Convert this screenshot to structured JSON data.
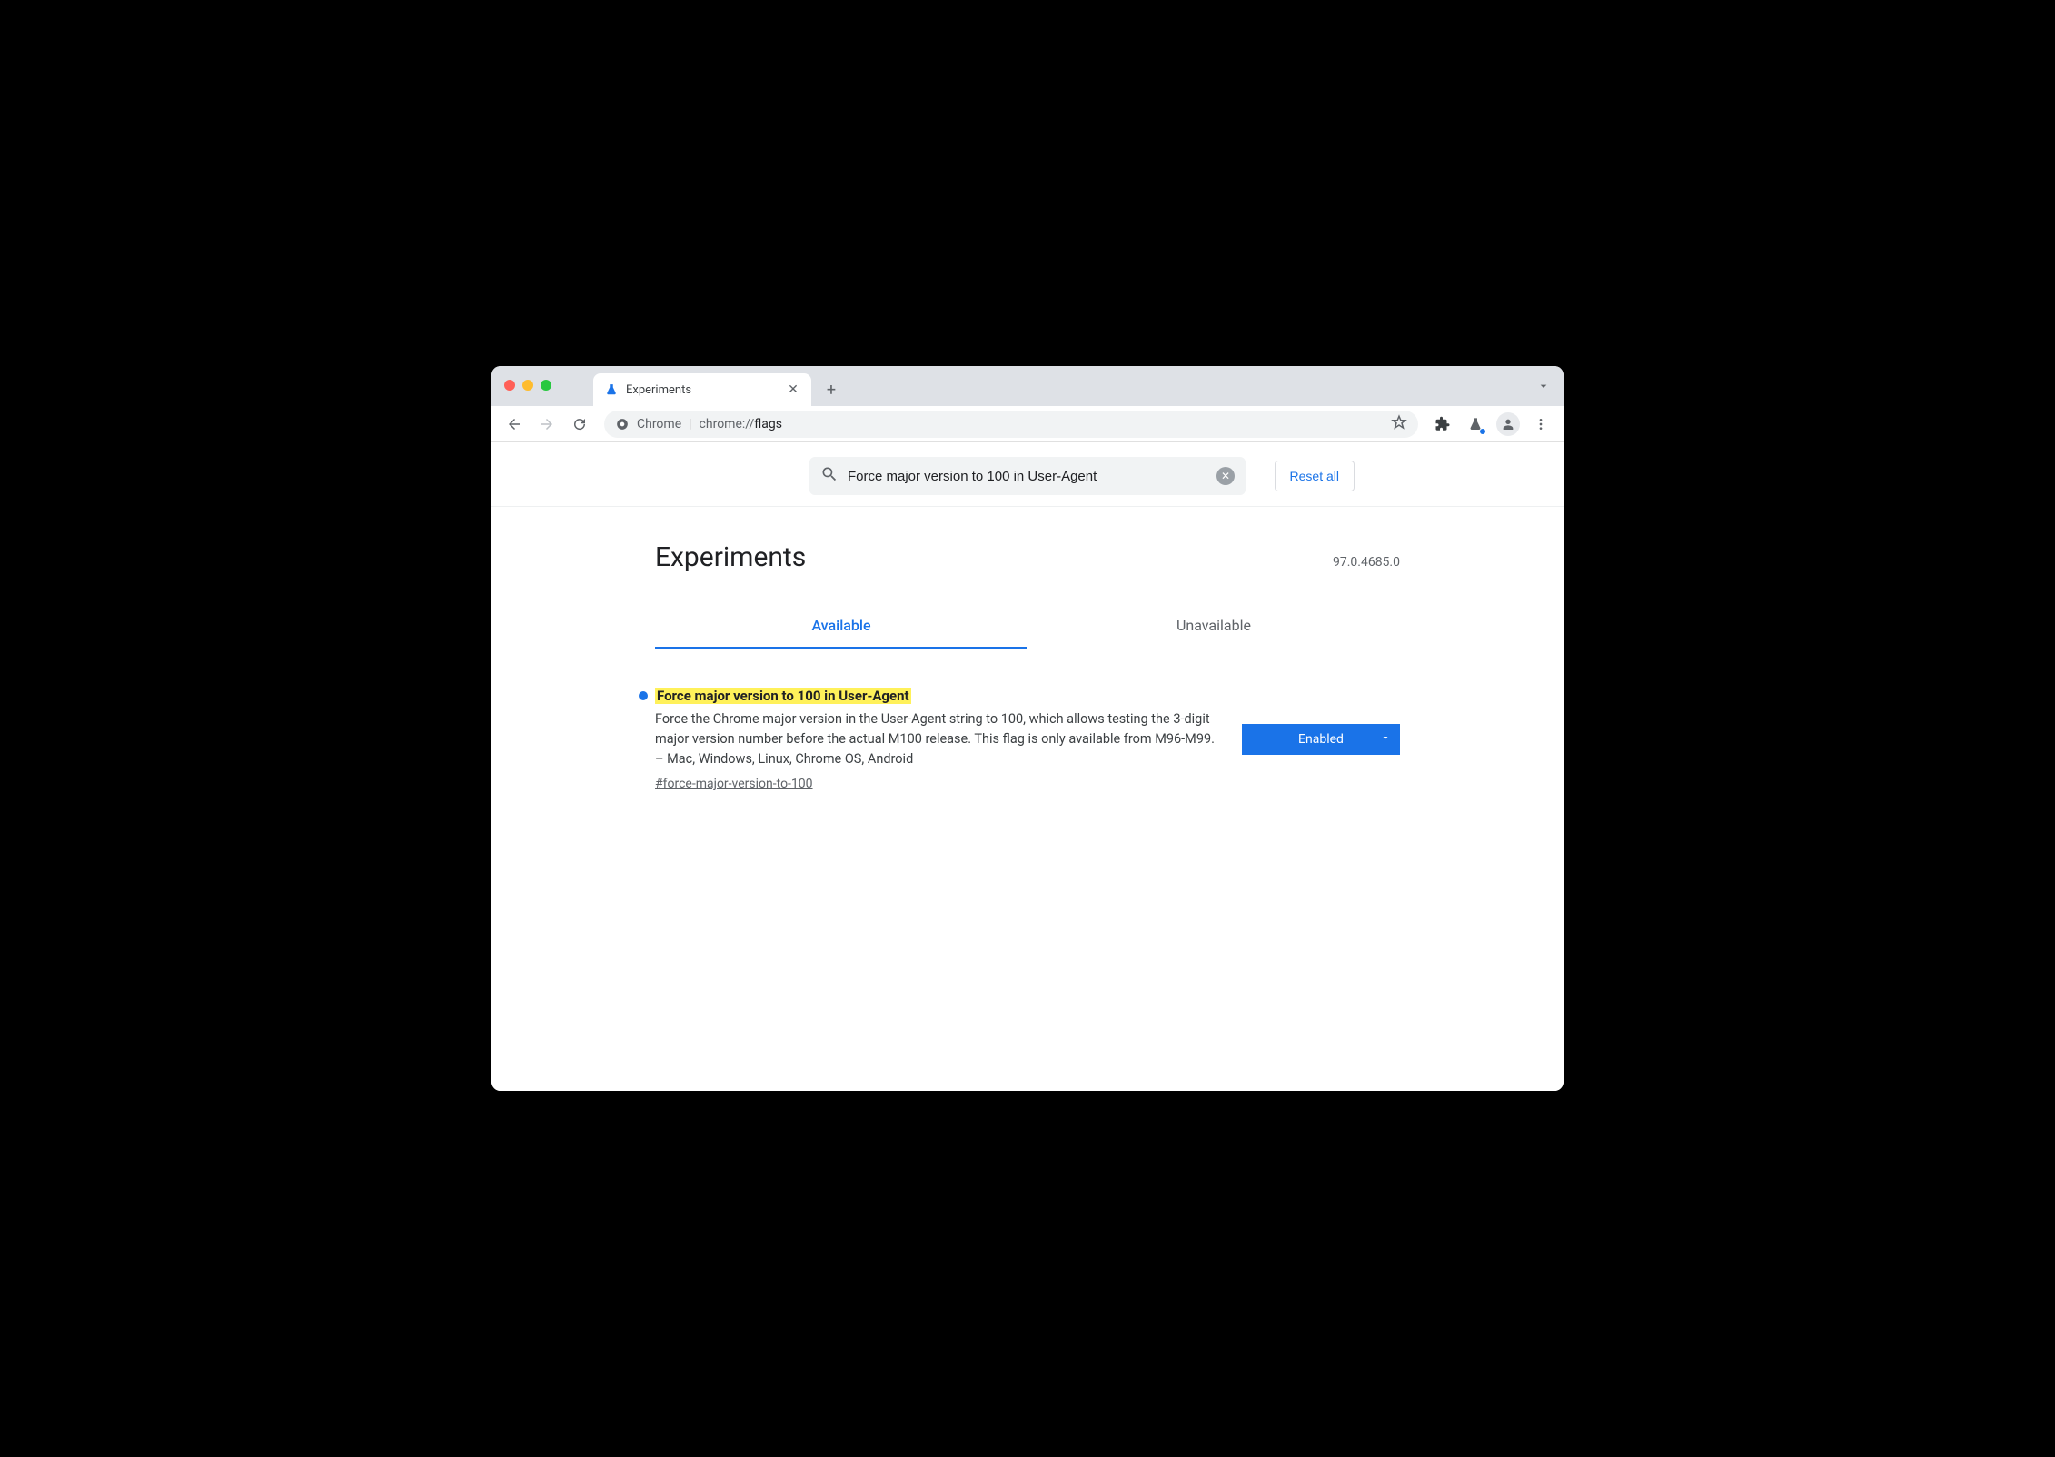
{
  "browser": {
    "tab_title": "Experiments",
    "address_label": "Chrome",
    "url_prefix": "chrome://",
    "url_path": "flags"
  },
  "search": {
    "value": "Force major version to 100 in User-Agent"
  },
  "buttons": {
    "reset_all": "Reset all"
  },
  "page": {
    "title": "Experiments",
    "version": "97.0.4685.0"
  },
  "tabs": [
    {
      "label": "Available",
      "active": true
    },
    {
      "label": "Unavailable",
      "active": false
    }
  ],
  "flag": {
    "title": "Force major version to 100 in User-Agent",
    "description": "Force the Chrome major version in the User-Agent string to 100, which allows testing the 3-digit major version number before the actual M100 release. This flag is only available from M96-M99. – Mac, Windows, Linux, Chrome OS, Android",
    "anchor": "#force-major-version-to-100",
    "state": "Enabled"
  }
}
